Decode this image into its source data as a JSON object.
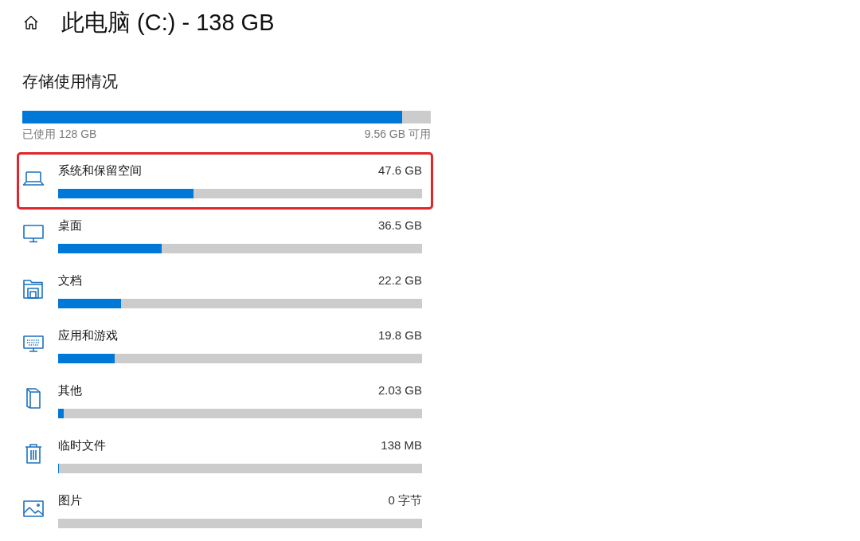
{
  "header": {
    "title": "此电脑 (C:) - 138 GB"
  },
  "usage": {
    "heading": "存储使用情况",
    "level": 0.93,
    "used": "已使用 128 GB",
    "free": "9.56 GB 可用"
  },
  "categories": [
    {
      "name": "系统和保留空间",
      "size": "47.6 GB",
      "level": 0.372,
      "highlighted": true
    },
    {
      "name": "桌面",
      "size": "36.5 GB",
      "level": 0.285,
      "highlighted": false
    },
    {
      "name": "文档",
      "size": "22.2 GB",
      "level": 0.173,
      "highlighted": false
    },
    {
      "name": "应用和游戏",
      "size": "19.8 GB",
      "level": 0.155,
      "highlighted": false
    },
    {
      "name": "其他",
      "size": "2.03 GB",
      "level": 0.016,
      "highlighted": false
    },
    {
      "name": "临时文件",
      "size": "138 MB",
      "level": 0.002,
      "highlighted": false
    },
    {
      "name": "图片",
      "size": "0 字节",
      "level": 0,
      "highlighted": false
    }
  ]
}
